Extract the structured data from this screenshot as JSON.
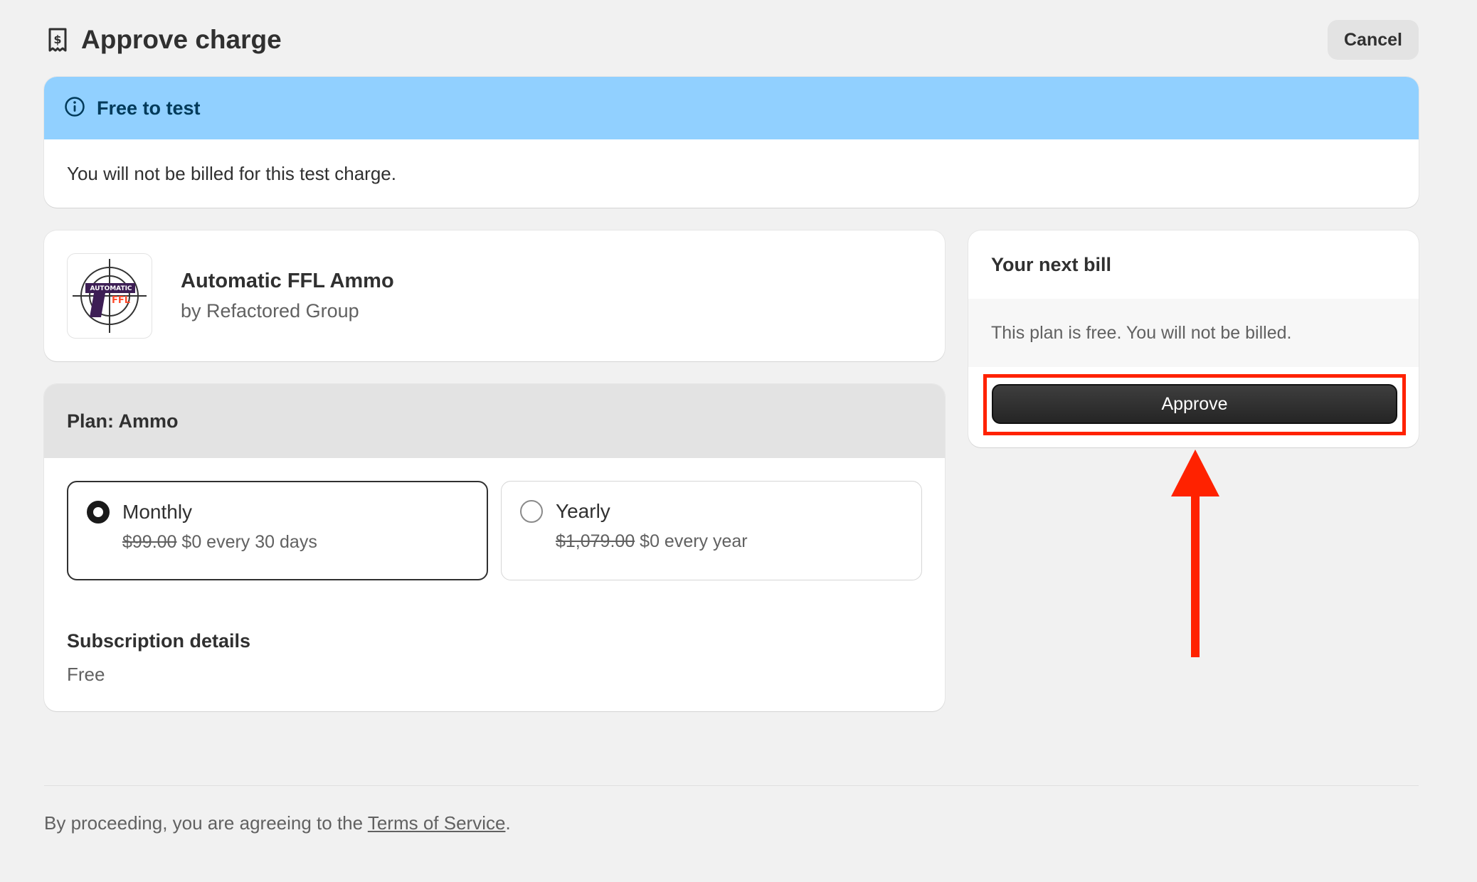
{
  "header": {
    "title": "Approve charge",
    "cancel_label": "Cancel",
    "icon": "receipt-dollar-icon"
  },
  "banner": {
    "title": "Free to test",
    "message": "You will not be billed for this test charge.",
    "icon": "info-icon",
    "color": "#91d0ff"
  },
  "app": {
    "name": "Automatic FFL Ammo",
    "by": "by Refactored Group",
    "logo_text_top": "AUTOMATIC",
    "logo_text_bottom": "FFL"
  },
  "plan": {
    "title": "Plan: Ammo",
    "options": [
      {
        "label": "Monthly",
        "old_price": "$99.00",
        "new_price": "$0 every 30 days",
        "selected": true
      },
      {
        "label": "Yearly",
        "old_price": "$1,079.00",
        "new_price": "$0 every year",
        "selected": false
      }
    ],
    "subscription_title": "Subscription details",
    "subscription_value": "Free"
  },
  "bill": {
    "title": "Your next bill",
    "message": "This plan is free. You will not be billed.",
    "approve_label": "Approve",
    "highlight_color": "#ff2200"
  },
  "footer": {
    "prefix": "By proceeding, you are agreeing to the ",
    "link": "Terms of Service",
    "suffix": "."
  }
}
